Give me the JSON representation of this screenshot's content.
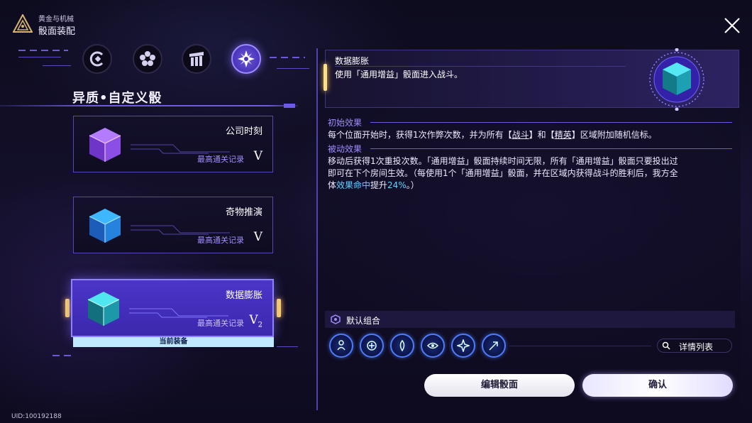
{
  "header": {
    "subtitle": "黄金与机械",
    "title": "骰面装配"
  },
  "tabs": [
    {
      "icon": "circle-c-icon",
      "active": false
    },
    {
      "icon": "flower-icon",
      "active": false
    },
    {
      "icon": "pillars-icon",
      "active": false
    },
    {
      "icon": "star-burst-icon",
      "active": true
    }
  ],
  "section_title": "异质•自定义骰",
  "dice": [
    {
      "name": "公司时刻",
      "record_label": "最高通关记录",
      "level": "V",
      "level_sub": "",
      "color": "#9b5cff"
    },
    {
      "name": "奇物推演",
      "record_label": "最高通关记录",
      "level": "V",
      "level_sub": "",
      "color": "#3aa0ff"
    },
    {
      "name": "数据膨胀",
      "record_label": "最高通关记录",
      "level": "V",
      "level_sub": "2",
      "color": "#2fd0e8",
      "selected": true
    }
  ],
  "equipped_badge": "当前装备",
  "detail": {
    "name": "数据膨胀",
    "desc": "使用「通用增益」骰面进入战斗。",
    "initial_title": "初始效果",
    "initial_text": {
      "a": "每个位面开始时，获得1次作弊次数，并为所有【",
      "u1": "战斗",
      "b": "】和【",
      "u2": "精英",
      "c": "】区域附加随机信标。"
    },
    "passive_title": "被动效果",
    "passive_line1": "移动后获得1次重投次数。「通用增益」骰面持续时间无限，所有「通用增益」骰面只要投出过",
    "passive_line2": "即可在下个房间生效。（每使用1个「通用增益」骰面，并在区域内获得战斗的胜利后，我方全",
    "passive_line3": {
      "a": "体",
      "hl": "效果命中",
      "b": "提升",
      "hl2": "24%",
      "c": "。）"
    }
  },
  "combo": {
    "label": "默认组合",
    "skills": [
      "path-icon-1",
      "swirl-icon",
      "flame-icon",
      "eye-icon",
      "burst-icon",
      "arrow-icon"
    ],
    "detail_button": "详情列表"
  },
  "buttons": {
    "edit": "编辑骰面",
    "confirm": "确认"
  },
  "uid": "UID:100192188",
  "colors": {
    "accent": "#6d5be3",
    "selected_card": "#3b28ad",
    "highlight": "#62d3ff",
    "bracket": "#ffd46a"
  }
}
